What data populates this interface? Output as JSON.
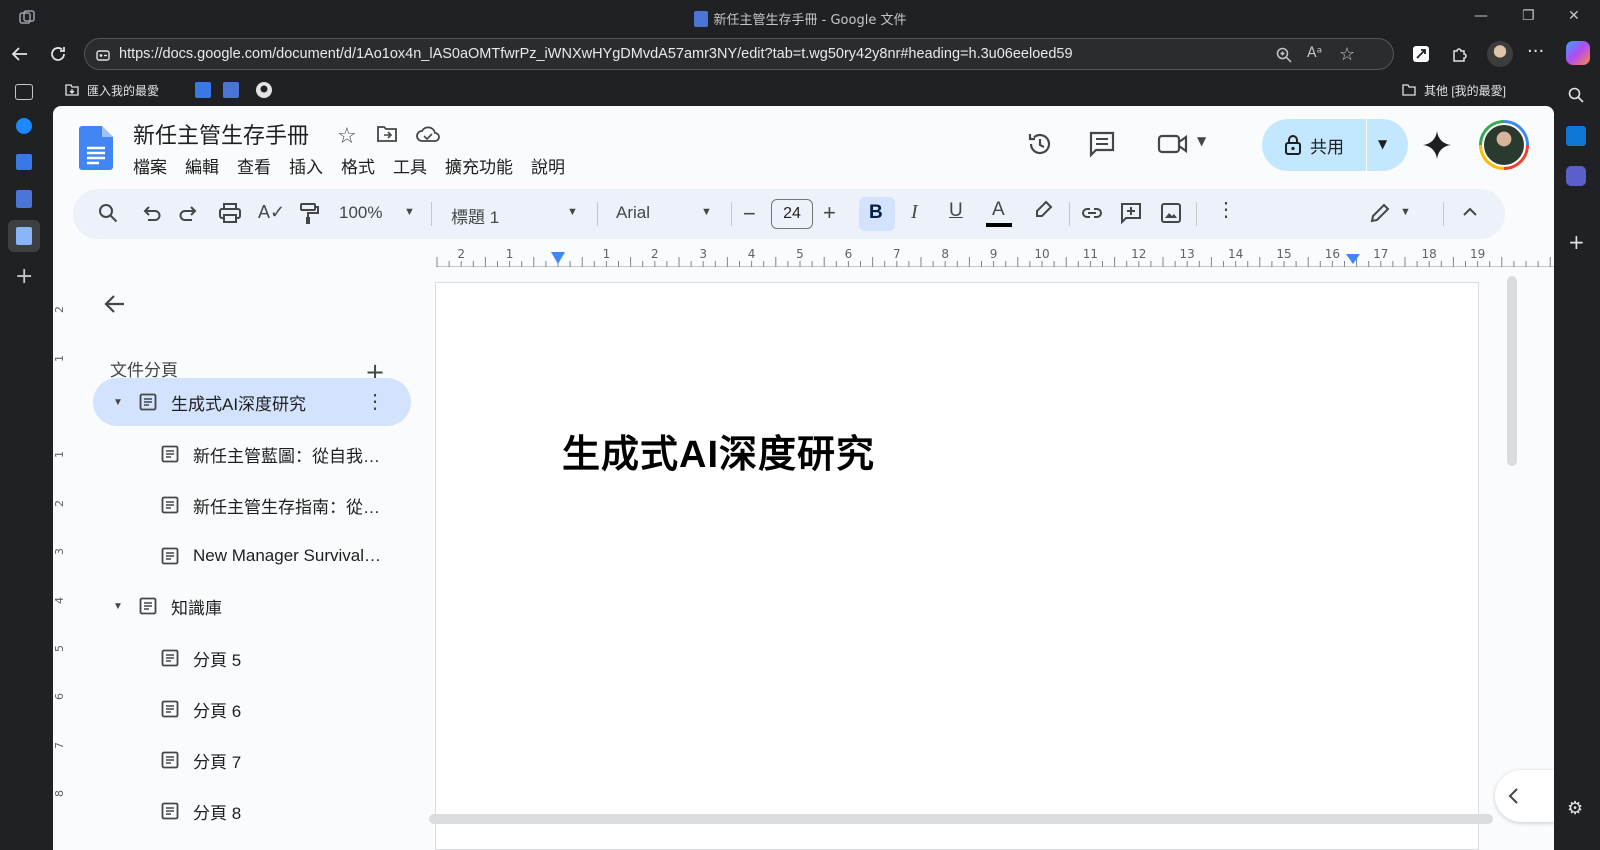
{
  "browser": {
    "window_title": "新任主管生存手冊 - Google 文件",
    "url": "https://docs.google.com/document/d/1Ao1ox4n_lAS0aOMTfwrPz_iWNXwHYgDMvdA57amr3NY/edit?tab=t.wg50ry42y8nr#heading=h.3u06eeloed59",
    "favorites": {
      "import_label": "匯入我的最愛",
      "other_label": "其他 [我的最愛]"
    }
  },
  "doc": {
    "title": "新任主管生存手冊",
    "menus": [
      "檔案",
      "編輯",
      "查看",
      "插入",
      "格式",
      "工具",
      "擴充功能",
      "說明"
    ],
    "share_label": "共用"
  },
  "toolbar": {
    "zoom": "100%",
    "style": "標題 1",
    "font": "Arial",
    "font_size": "24"
  },
  "ruler": {
    "h_numbers": [
      "2",
      "1",
      "1",
      "2",
      "3",
      "4",
      "5",
      "6",
      "7",
      "8",
      "9",
      "10",
      "11",
      "12",
      "13",
      "14",
      "15",
      "16",
      "17",
      "18",
      "19"
    ],
    "v_numbers": [
      "2",
      "1",
      "1",
      "2",
      "3",
      "4",
      "5",
      "6",
      "7",
      "8"
    ]
  },
  "outline": {
    "heading": "文件分頁",
    "tabs": [
      {
        "label": "生成式AI深度研究",
        "level": 0,
        "active": true,
        "expanded": true
      },
      {
        "label": "新任主管藍圖：從自我…",
        "level": 1
      },
      {
        "label": "新任主管生存指南：從…",
        "level": 1
      },
      {
        "label": "New Manager Survival…",
        "level": 1
      },
      {
        "label": "知識庫",
        "level": 0,
        "expanded": true
      },
      {
        "label": "分頁 5",
        "level": 1
      },
      {
        "label": "分頁 6",
        "level": 1
      },
      {
        "label": "分頁 7",
        "level": 1
      },
      {
        "label": "分頁 8",
        "level": 1
      }
    ]
  },
  "page": {
    "heading": "生成式AI深度研究"
  },
  "colors": {
    "share_bg": "#c2e7ff",
    "active_tab_bg": "#d3e3fd",
    "toolbar_bg": "#edf2fa",
    "docs_blue": "#4285f4"
  },
  "icons": [
    "search-icon",
    "undo-icon",
    "redo-icon",
    "print-icon",
    "spellcheck-icon",
    "paint-format-icon",
    "history-icon",
    "comments-icon",
    "meet-icon",
    "lock-icon",
    "gemini-icon",
    "back-arrow-icon",
    "add-icon",
    "doc-icon",
    "more-vert-icon"
  ]
}
